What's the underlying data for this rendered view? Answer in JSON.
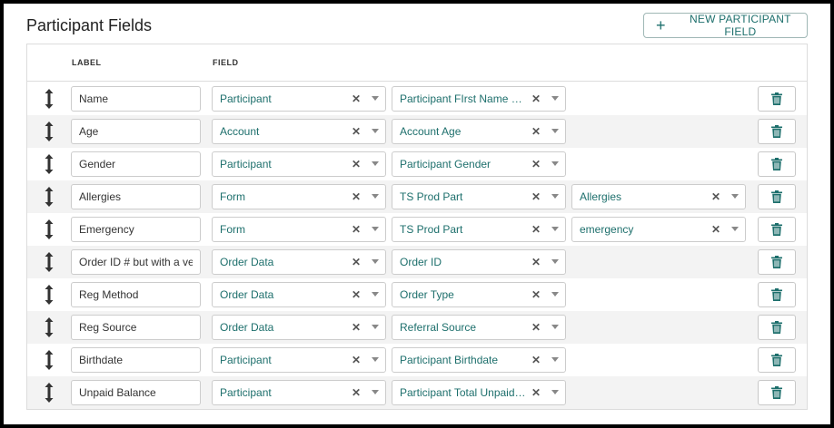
{
  "page": {
    "title": "Participant Fields",
    "new_button_label": "NEW PARTICIPANT FIELD"
  },
  "table": {
    "headers": {
      "label": "LABEL",
      "field": "FIELD"
    },
    "rows": [
      {
        "label": "Name",
        "field": "Participant",
        "subfield": "Participant FIrst Name Only",
        "extra": ""
      },
      {
        "label": "Age",
        "field": "Account",
        "subfield": "Account Age",
        "extra": ""
      },
      {
        "label": "Gender",
        "field": "Participant",
        "subfield": "Participant Gender",
        "extra": ""
      },
      {
        "label": "Allergies",
        "field": "Form",
        "subfield": "TS Prod Part",
        "extra": "Allergies"
      },
      {
        "label": "Emergency",
        "field": "Form",
        "subfield": "TS Prod Part",
        "extra": "emergency"
      },
      {
        "label": "Order ID # but with a very long label",
        "field": "Order Data",
        "subfield": "Order ID",
        "extra": ""
      },
      {
        "label": "Reg Method",
        "field": "Order Data",
        "subfield": "Order Type",
        "extra": ""
      },
      {
        "label": "Reg Source",
        "field": "Order Data",
        "subfield": "Referral Source",
        "extra": ""
      },
      {
        "label": "Birthdate",
        "field": "Participant",
        "subfield": "Participant Birthdate",
        "extra": ""
      },
      {
        "label": "Unpaid Balance",
        "field": "Participant",
        "subfield": "Participant Total Unpaid Balance",
        "extra": ""
      }
    ]
  },
  "icons": {
    "new": "plus-icon",
    "drag": "drag-vertical-icon",
    "clear": "clear-x-icon",
    "dropdown": "chevron-down-icon",
    "delete": "trash-icon"
  },
  "colors": {
    "accent": "#1d6f6c",
    "row_alt": "#f3f3f3",
    "border": "#cccccc"
  }
}
